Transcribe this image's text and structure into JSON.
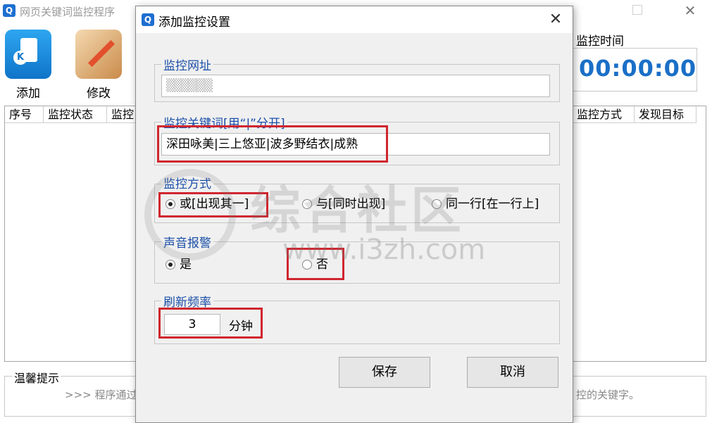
{
  "app": {
    "icon": "magnifier-app-icon",
    "title": "网页关键词监控程序"
  },
  "toolbar": {
    "add_label": "添加",
    "edit_label": "修改"
  },
  "monitor_time": {
    "label": "监控时间",
    "value": "00:00:00",
    "value_color": "#1a6fc7"
  },
  "table": {
    "columns": [
      "序号",
      "监控状态",
      "监控",
      "监控方式",
      "发现目标"
    ]
  },
  "tips": {
    "legend": "温馨提示",
    "text_left": ">>> 程序通过",
    "text_right": "控的关键字。"
  },
  "dialog": {
    "title": "添加监控设置",
    "url": {
      "legend": "监控网址",
      "value": "▒▒▒▒ ▒▒"
    },
    "keywords": {
      "legend": "监控关键词[用“|”分开]",
      "value": "深田咏美|三上悠亚|波多野结衣|成熟"
    },
    "mode": {
      "legend": "监控方式",
      "options": [
        "或[出现其一]",
        "与[同时出现]",
        "同一行[在一行上]"
      ],
      "selected": 0
    },
    "sound": {
      "legend": "声音报警",
      "options": [
        "是",
        "否"
      ],
      "selected": 0
    },
    "refresh": {
      "legend": "刷新频率",
      "value": "3",
      "unit": "分钟"
    },
    "save_label": "保存",
    "cancel_label": "取消"
  },
  "watermark": {
    "main": "综合社区",
    "url": "www.i3zh.com"
  },
  "colors": {
    "highlight": "#d0262e",
    "legend_text": "#1a4fa8",
    "dialog_bg": "#f0f0f0"
  }
}
